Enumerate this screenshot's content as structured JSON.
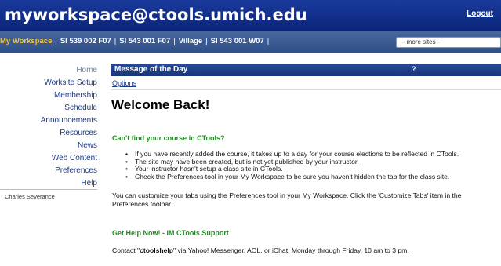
{
  "header": {
    "site_title": "myworkspace@ctools.umich.edu",
    "logout_label": "Logout",
    "bg_color": "#0e2d8c"
  },
  "site_nav": {
    "tabs": [
      {
        "label": "My Workspace",
        "current": true
      },
      {
        "label": "SI 539 002 F07",
        "current": false
      },
      {
        "label": "SI 543 001 F07",
        "current": false
      },
      {
        "label": "Village",
        "current": false
      },
      {
        "label": "SI 543 001 W07",
        "current": false
      }
    ],
    "separator": "|",
    "more_sites_label": "– more sites –",
    "current_color": "#f0c23a"
  },
  "left_nav": {
    "items": [
      "Home",
      "Worksite Setup",
      "Membership",
      "Schedule",
      "Announcements",
      "Resources",
      "News",
      "Web Content",
      "Preferences",
      "Help"
    ],
    "presence_user": "Charles Severance"
  },
  "tool": {
    "title": "Message of the Day",
    "help_icon": "?",
    "options_label": "Options"
  },
  "content": {
    "welcome": "Welcome Back!",
    "find_heading": "Can't find your course in CTools?",
    "bullets": [
      "If you have recently added the course, it takes up to a day for your course elections to be reflected in CTools.",
      "The site may have been created, but is not yet published by your instructor.",
      "Your instructor hasn't setup a class site in CTools.",
      "Check the Preferences tool in your My Workspace to be sure you haven't hidden the tab for the class site."
    ],
    "customize_text": "You can customize your tabs using the Preferences tool in your My Workspace. Click the 'Customize Tabs' item in the Preferences toolbar.",
    "help_heading": "Get Help Now! - IM CTools Support",
    "contact_prefix": "Contact \"",
    "contact_handle": "ctoolshelp",
    "contact_suffix": "\" via Yahoo! Messenger, AOL, or iChat: Monday through Friday, 10 am to 3 pm."
  }
}
